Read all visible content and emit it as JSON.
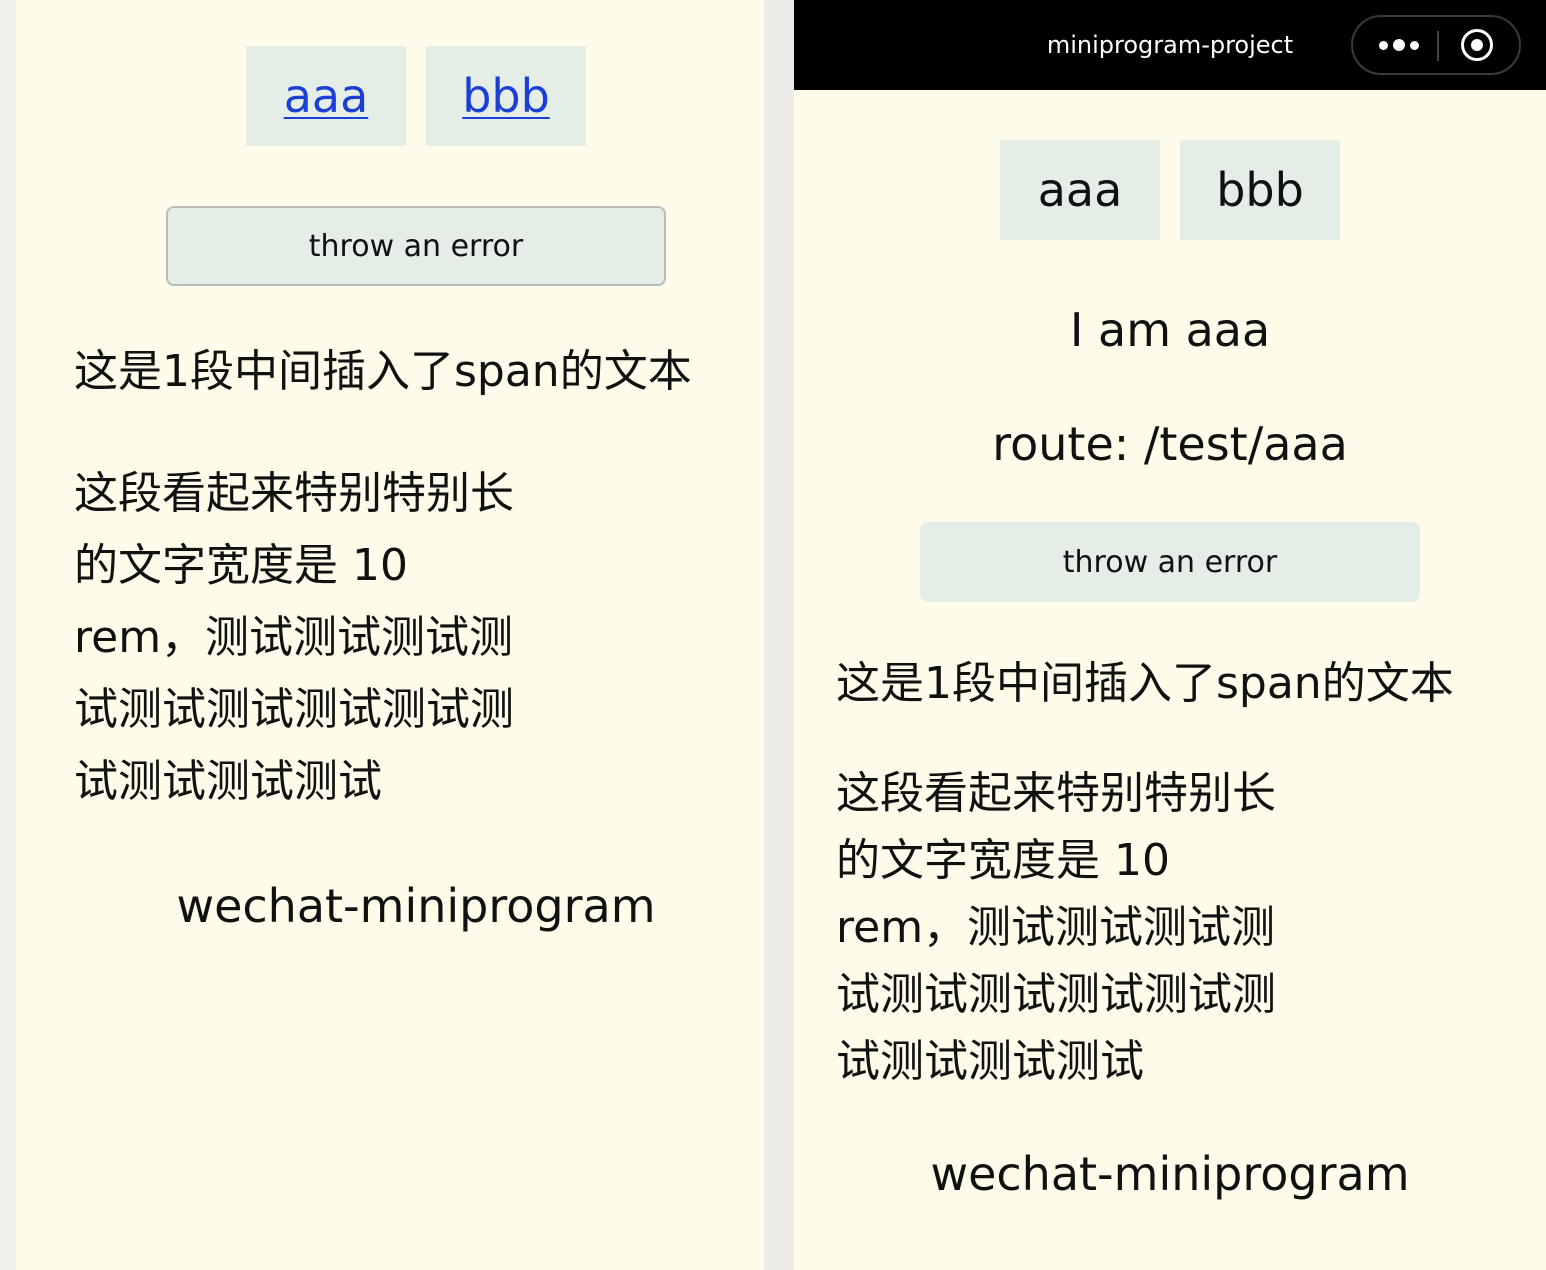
{
  "left": {
    "tabs": [
      "aaa",
      "bbb"
    ],
    "error_button": "throw an error",
    "span_text": "这是1段中间插入了span的文本",
    "long_text": [
      "这段看起来特别特别长",
      "的文字宽度是 10",
      "rem，测试测试测试测",
      "试测试测试测试测试测",
      "试测试测试测试"
    ],
    "footer": "wechat-miniprogram"
  },
  "right": {
    "navbar": {
      "title": "miniprogram-project",
      "menu_icon": "more-dots-icon",
      "close_icon": "target-circle-icon"
    },
    "tabs": [
      "aaa",
      "bbb"
    ],
    "page_text": "I am aaa",
    "route_text": "route: /test/aaa",
    "error_button": "throw an error",
    "span_text": "这是1段中间插入了span的文本",
    "long_text": [
      "这段看起来特别特别长",
      "的文字宽度是 10",
      "rem，测试测试测试测",
      "试测试测试测试测试测",
      "试测试测试测试"
    ],
    "footer": "wechat-miniprogram"
  },
  "colors": {
    "page_background": "#fefbea",
    "tab_background": "#e5ede7",
    "link": "#1a3fd6",
    "navbar": "#000000"
  }
}
